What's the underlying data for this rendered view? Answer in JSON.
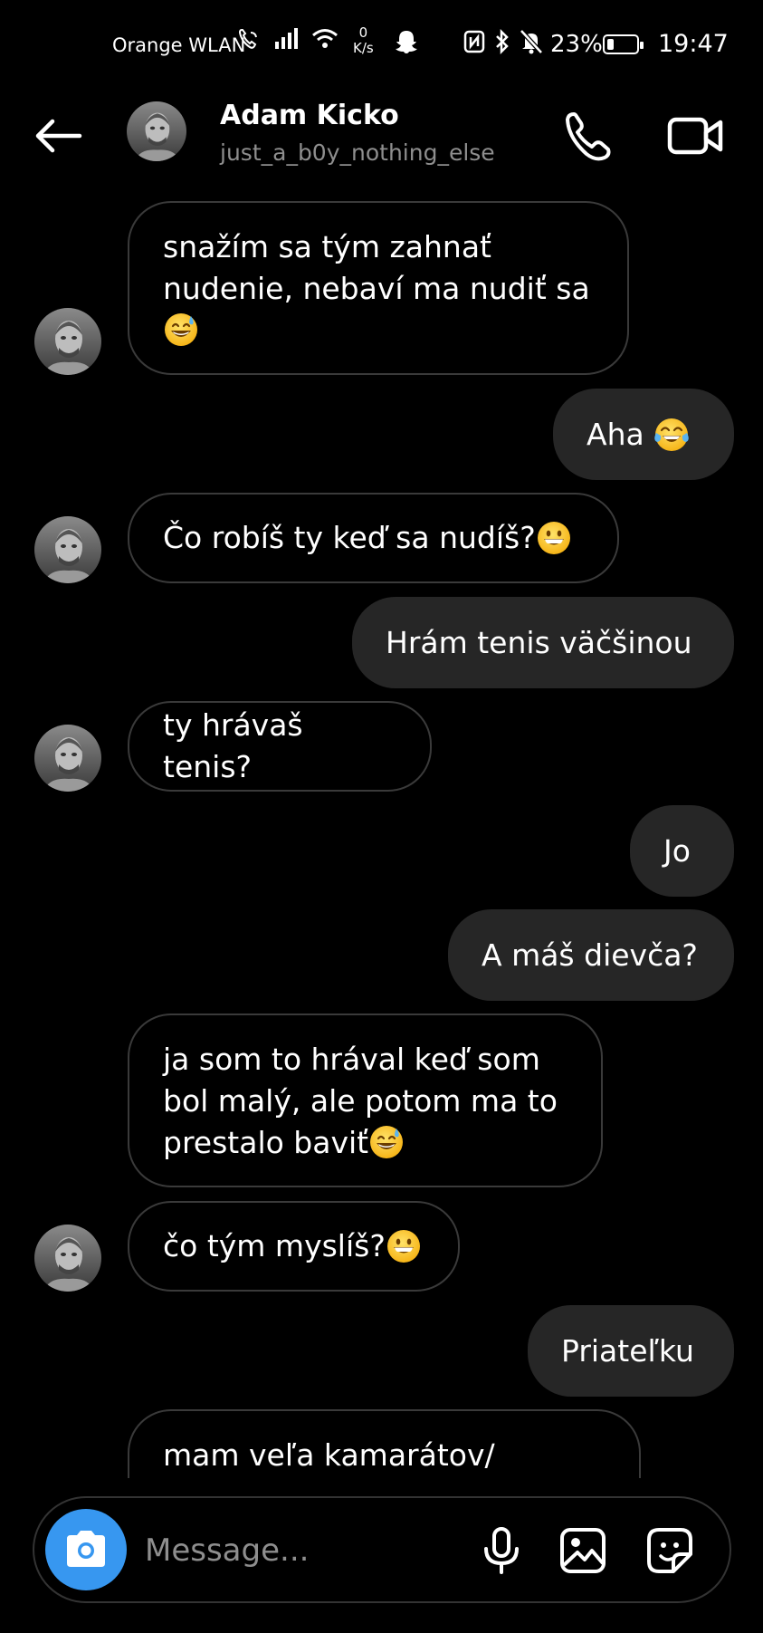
{
  "status_bar": {
    "carrier": "Orange WLAN",
    "speed_value": "0",
    "speed_unit": "K/s",
    "battery": "23%",
    "battery_level": 0.23,
    "time": "19:47"
  },
  "header": {
    "name": "Adam Kicko",
    "username": "just_a_b0y_nothing_else"
  },
  "messages": [
    {
      "side": "in",
      "lines": [
        "snažím sa tým zahnať",
        "nudenie, nebaví ma nudiť sa"
      ],
      "emoji": "sweat-smile"
    },
    {
      "side": "out",
      "text": "Aha",
      "emoji": "tears-of-joy"
    },
    {
      "side": "in",
      "text": "Čo robíš ty keď sa nudíš?",
      "emoji": "grin"
    },
    {
      "side": "out",
      "text": "Hrám tenis väčšinou"
    },
    {
      "side": "in",
      "text": "ty hrávaš tenis?"
    },
    {
      "side": "out",
      "text": "Jo"
    },
    {
      "side": "out",
      "text": "A máš dievča?"
    },
    {
      "side": "in",
      "lines": [
        "ja som to hrával keď som",
        "bol malý, ale potom ma to",
        "prestalo baviť"
      ],
      "emoji": "sweat-smile"
    },
    {
      "side": "in",
      "text": "čo tým myslíš?",
      "emoji": "grin"
    },
    {
      "side": "out",
      "text": "Priateľku"
    },
    {
      "side": "in",
      "text": "mam veľa kamarátov/"
    }
  ],
  "composer": {
    "placeholder": "Message..."
  },
  "colors": {
    "background": "#000000",
    "outgoing_bubble": "#262626",
    "incoming_border": "#3a3a3a",
    "camera_accent": "#3797f0",
    "secondary_text": "#8e8e8e"
  },
  "icons": [
    "back-arrow-icon",
    "phone-icon",
    "video-camera-icon",
    "camera-icon",
    "microphone-icon",
    "image-icon",
    "sticker-icon"
  ]
}
